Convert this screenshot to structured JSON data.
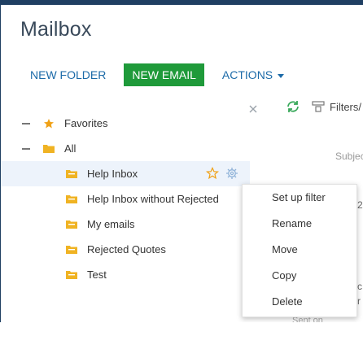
{
  "header": {
    "title": "Mailbox"
  },
  "toolbar": {
    "new_folder_label": "NEW FOLDER",
    "new_email_label": "NEW EMAIL",
    "actions_label": "ACTIONS"
  },
  "right_tools": {
    "filters_label": "Filters/"
  },
  "list": {
    "subject_header": "Subjec",
    "sent_on_header": "Sent on",
    "fragments": [
      "2",
      "c",
      "r"
    ]
  },
  "tree": {
    "favorites_label": "Favorites",
    "all_label": "All",
    "folders": [
      {
        "label": "Help Inbox",
        "selected": true
      },
      {
        "label": "Help Inbox without Rejected"
      },
      {
        "label": "My emails"
      },
      {
        "label": "Rejected Quotes"
      },
      {
        "label": "Test"
      }
    ]
  },
  "context_menu": {
    "items": [
      "Set up filter",
      "Rename",
      "Move",
      "Copy",
      "Delete"
    ]
  },
  "colors": {
    "accent_blue": "#1b6aa8",
    "primary_green": "#1f9a3a",
    "folder_yellow": "#f0b323",
    "star_orange": "#f0a116"
  }
}
